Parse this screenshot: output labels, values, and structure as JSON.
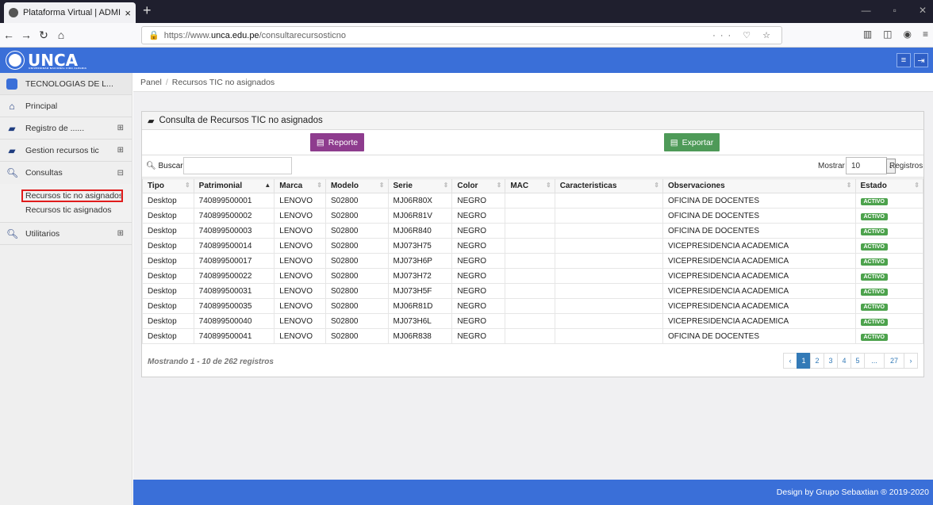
{
  "browser": {
    "tab_title": "Plataforma Virtual | ADMIN",
    "tab_close": "×",
    "new_tab": "+",
    "url_prefix": "https://www.",
    "url_domain": "unca.edu.pe",
    "url_path": "/consultarecursosticno",
    "url_actions": "··· ♡ ☆"
  },
  "header": {
    "logo_text": "UNCA",
    "logo_sub": "UNIVERSIDAD NACIONAL CIRO ALEGRIA"
  },
  "sidebar": {
    "user": "TECNOLOGIAS DE L...",
    "items": [
      {
        "label": "Principal"
      },
      {
        "label": "Registro de ......"
      },
      {
        "label": "Gestion recursos tic"
      },
      {
        "label": "Consultas"
      },
      {
        "label": "Utilitarios"
      }
    ],
    "sub": [
      "Recursos tic no asignados",
      "Recursos tic asignados"
    ]
  },
  "breadcrumb": {
    "root": "Panel",
    "current": "Recursos TIC no asignados"
  },
  "card": {
    "title": "Consulta de Recursos TIC no asignados",
    "reporte": "Reporte",
    "exportar": "Exportar",
    "search_label": "Buscar:",
    "mostrar": "Mostrar",
    "page_size": "10",
    "registros": "Registros"
  },
  "table": {
    "headers": [
      "Tipo",
      "Patrimonial",
      "Marca",
      "Modelo",
      "Serie",
      "Color",
      "MAC",
      "Caracteristicas",
      "Observaciones",
      "Estado"
    ],
    "rows": [
      [
        "Desktop",
        "740899500001",
        "LENOVO",
        "S02800",
        "MJ06R80X",
        "NEGRO",
        "",
        "",
        "OFICINA DE DOCENTES",
        "ACTIVO"
      ],
      [
        "Desktop",
        "740899500002",
        "LENOVO",
        "S02800",
        "MJ06R81V",
        "NEGRO",
        "",
        "",
        "OFICINA DE DOCENTES",
        "ACTIVO"
      ],
      [
        "Desktop",
        "740899500003",
        "LENOVO",
        "S02800",
        "MJ06R840",
        "NEGRO",
        "",
        "",
        "OFICINA DE DOCENTES",
        "ACTIVO"
      ],
      [
        "Desktop",
        "740899500014",
        "LENOVO",
        "S02800",
        "MJ073H75",
        "NEGRO",
        "",
        "",
        "VICEPRESIDENCIA ACADEMICA",
        "ACTIVO"
      ],
      [
        "Desktop",
        "740899500017",
        "LENOVO",
        "S02800",
        "MJ073H6P",
        "NEGRO",
        "",
        "",
        "VICEPRESIDENCIA ACADEMICA",
        "ACTIVO"
      ],
      [
        "Desktop",
        "740899500022",
        "LENOVO",
        "S02800",
        "MJ073H72",
        "NEGRO",
        "",
        "",
        "VICEPRESIDENCIA ACADEMICA",
        "ACTIVO"
      ],
      [
        "Desktop",
        "740899500031",
        "LENOVO",
        "S02800",
        "MJ073H5F",
        "NEGRO",
        "",
        "",
        "VICEPRESIDENCIA ACADEMICA",
        "ACTIVO"
      ],
      [
        "Desktop",
        "740899500035",
        "LENOVO",
        "S02800",
        "MJ06R81D",
        "NEGRO",
        "",
        "",
        "VICEPRESIDENCIA ACADEMICA",
        "ACTIVO"
      ],
      [
        "Desktop",
        "740899500040",
        "LENOVO",
        "S02800",
        "MJ073H6L",
        "NEGRO",
        "",
        "",
        "VICEPRESIDENCIA ACADEMICA",
        "ACTIVO"
      ],
      [
        "Desktop",
        "740899500041",
        "LENOVO",
        "S02800",
        "MJ06R838",
        "NEGRO",
        "",
        "",
        "OFICINA DE DOCENTES",
        "ACTIVO"
      ]
    ],
    "info": "Mostrando 1 - 10 de 262 registros",
    "pages": [
      "‹",
      "1",
      "2",
      "3",
      "4",
      "5",
      "...",
      "27",
      "›"
    ]
  },
  "footer": {
    "text": "Design by Grupo Sebaxtian ® 2019-2020"
  },
  "colors": {
    "header": "#3a6fd8",
    "reporte": "#8e3c8e",
    "exportar": "#4e9a58",
    "badge": "#4ca24c"
  }
}
